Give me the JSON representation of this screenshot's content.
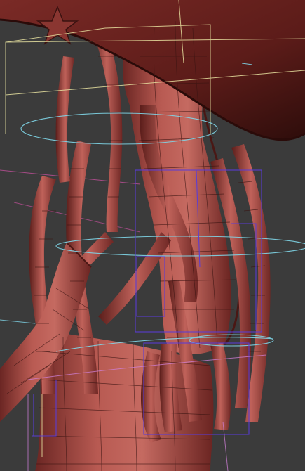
{
  "viewport": {
    "background": "#3b3b3b",
    "mesh_color": "#b0524c",
    "mesh_shadow": "#5e1f1c",
    "wire_color": "#3a1412",
    "guide_colors": {
      "cage": "#e8e2a0",
      "ring": "#7fd6e8",
      "bbox": "#5a3cd8",
      "line": "#c070c8"
    }
  }
}
